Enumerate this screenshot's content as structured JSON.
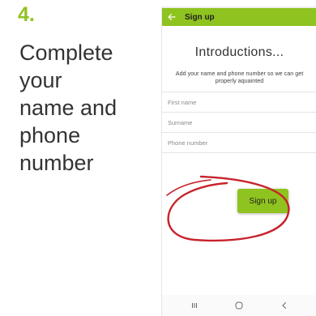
{
  "tutorial": {
    "step_number": "4.",
    "instruction_lines": [
      "Complete",
      "your",
      "name and",
      "phone",
      "number"
    ]
  },
  "app_bar": {
    "title": "Sign up",
    "back_icon": "arrow-left-icon"
  },
  "screen": {
    "heading": "Introductions...",
    "subtext": "Add your name and phone number so we can get properly aquainted"
  },
  "form": {
    "first_name": {
      "placeholder": "First name",
      "value": ""
    },
    "surname": {
      "placeholder": "Surname",
      "value": ""
    },
    "phone_number": {
      "placeholder": "Phone number",
      "value": ""
    }
  },
  "signup_button": {
    "label": "Sign up"
  },
  "nav_bar": {
    "recents_icon": "recents-icon",
    "home_icon": "home-icon",
    "back_icon": "chevron-left-icon"
  },
  "colors": {
    "brand_green": "#8fc31f",
    "annotation_red": "#c8232c",
    "text_dark": "#333333"
  }
}
